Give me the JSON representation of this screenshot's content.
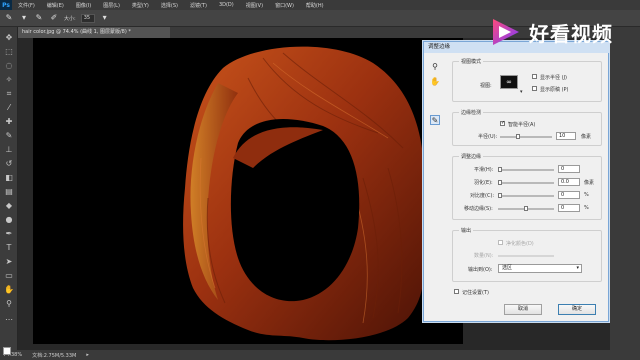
{
  "menubar": {
    "logo": "Ps",
    "items": [
      "文件(F)",
      "编辑(E)",
      "图像(I)",
      "图层(L)",
      "类型(Y)",
      "选择(S)",
      "滤镜(T)",
      "3D(D)",
      "视图(V)",
      "窗口(W)",
      "帮助(H)"
    ]
  },
  "options": {
    "size_label": "大小:",
    "size_value": "35"
  },
  "document_tab": {
    "title": "hair color.jpg @ 74.4% (曲线 1, 图层蒙版/8) *"
  },
  "dialog": {
    "title": "调整边缘",
    "view_mode": {
      "group": "视图模式",
      "view_label": "视图:",
      "show_radius": "显示半径 (J)",
      "show_original": "显示原稿 (P)"
    },
    "edge_detection": {
      "group": "边缘检测",
      "smart_radius": "智能半径(A)",
      "radius_label": "半径(U):",
      "radius_value": "10",
      "radius_unit": "像素"
    },
    "adjust_edge": {
      "group": "调整边缘",
      "smooth_label": "平滑(H):",
      "smooth_value": "0",
      "feather_label": "羽化(E):",
      "feather_value": "0.0",
      "feather_unit": "像素",
      "contrast_label": "对比度(C):",
      "contrast_value": "0",
      "contrast_unit": "%",
      "shift_label": "移动边缘(S):",
      "shift_value": "0",
      "shift_unit": "%"
    },
    "output": {
      "group": "输出",
      "decontaminate": "净化颜色(D)",
      "amount_label": "数量(N):",
      "output_to_label": "输出到(O):",
      "output_to_value": "选区"
    },
    "remember": "记住设置(T)",
    "cancel": "取消",
    "ok": "确定"
  },
  "statusbar": {
    "zoom": "74.38%",
    "doc": "文档:2.75M/5.33M"
  },
  "watermark": {
    "text": "好看视频"
  },
  "colors": {
    "hair_dark": "#5a1a08",
    "hair_mid": "#a2360f",
    "hair_light": "#d0661f",
    "dialog_bg": "#f0f0f0",
    "accent": "#3c7fb1"
  }
}
